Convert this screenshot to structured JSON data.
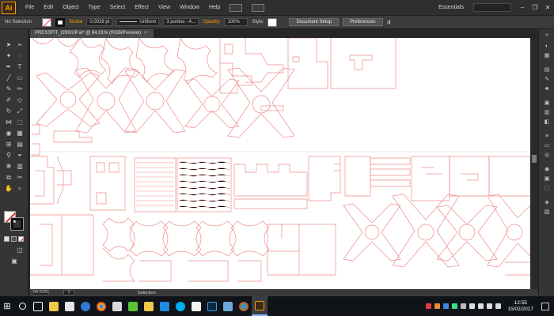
{
  "app": {
    "logo": "Ai"
  },
  "menu": [
    "File",
    "Edit",
    "Object",
    "Type",
    "Select",
    "Effect",
    "View",
    "Window",
    "Help"
  ],
  "workspace": "Essentials",
  "window_controls": [
    "–",
    "❐",
    "✕"
  ],
  "control_bar": {
    "selection": "No Selection",
    "stroke_label": "Stroke",
    "stroke_weight": "0,0028 pt",
    "profile": "Uniform",
    "brush": "3 pontos - A...",
    "opacity_label": "Opacity:",
    "opacity_value": "100%",
    "style_label": "Style:",
    "document_setup": "Document Setup",
    "preferences": "Preferences"
  },
  "document_tab": {
    "title": "PRESSFIT_GROUP.ai* @ 84,01% (RGB/Preview)",
    "close": "×"
  },
  "status_bar": {
    "zoom": "84,01%",
    "page": "1",
    "tool": "Selection"
  },
  "taskbar": {
    "apps": [
      {
        "name": "search",
        "color": "#ffffff"
      },
      {
        "name": "task-view",
        "color": "#ffffff"
      },
      {
        "name": "file-explorer",
        "color": "#f2c84b"
      },
      {
        "name": "store",
        "color": "#ffffff"
      },
      {
        "name": "edge",
        "color": "#2f7bd6"
      },
      {
        "name": "chrome",
        "color": "#ea4335"
      },
      {
        "name": "calculator",
        "color": "#e6e6e6"
      },
      {
        "name": "whatsapp",
        "color": "#5bc236"
      },
      {
        "name": "files",
        "color": "#f2c84b"
      },
      {
        "name": "code",
        "color": "#1e88e5"
      },
      {
        "name": "skype",
        "color": "#00aff0"
      },
      {
        "name": "media",
        "color": "#f2f2f2"
      },
      {
        "name": "photoshop",
        "color": "#2ea3f2"
      },
      {
        "name": "photo",
        "color": "#6fa8dc"
      },
      {
        "name": "chrome2",
        "color": "#ea4335"
      },
      {
        "name": "illustrator",
        "color": "#ff9a00"
      }
    ],
    "time": "12:55",
    "date": "15/02/2017"
  }
}
